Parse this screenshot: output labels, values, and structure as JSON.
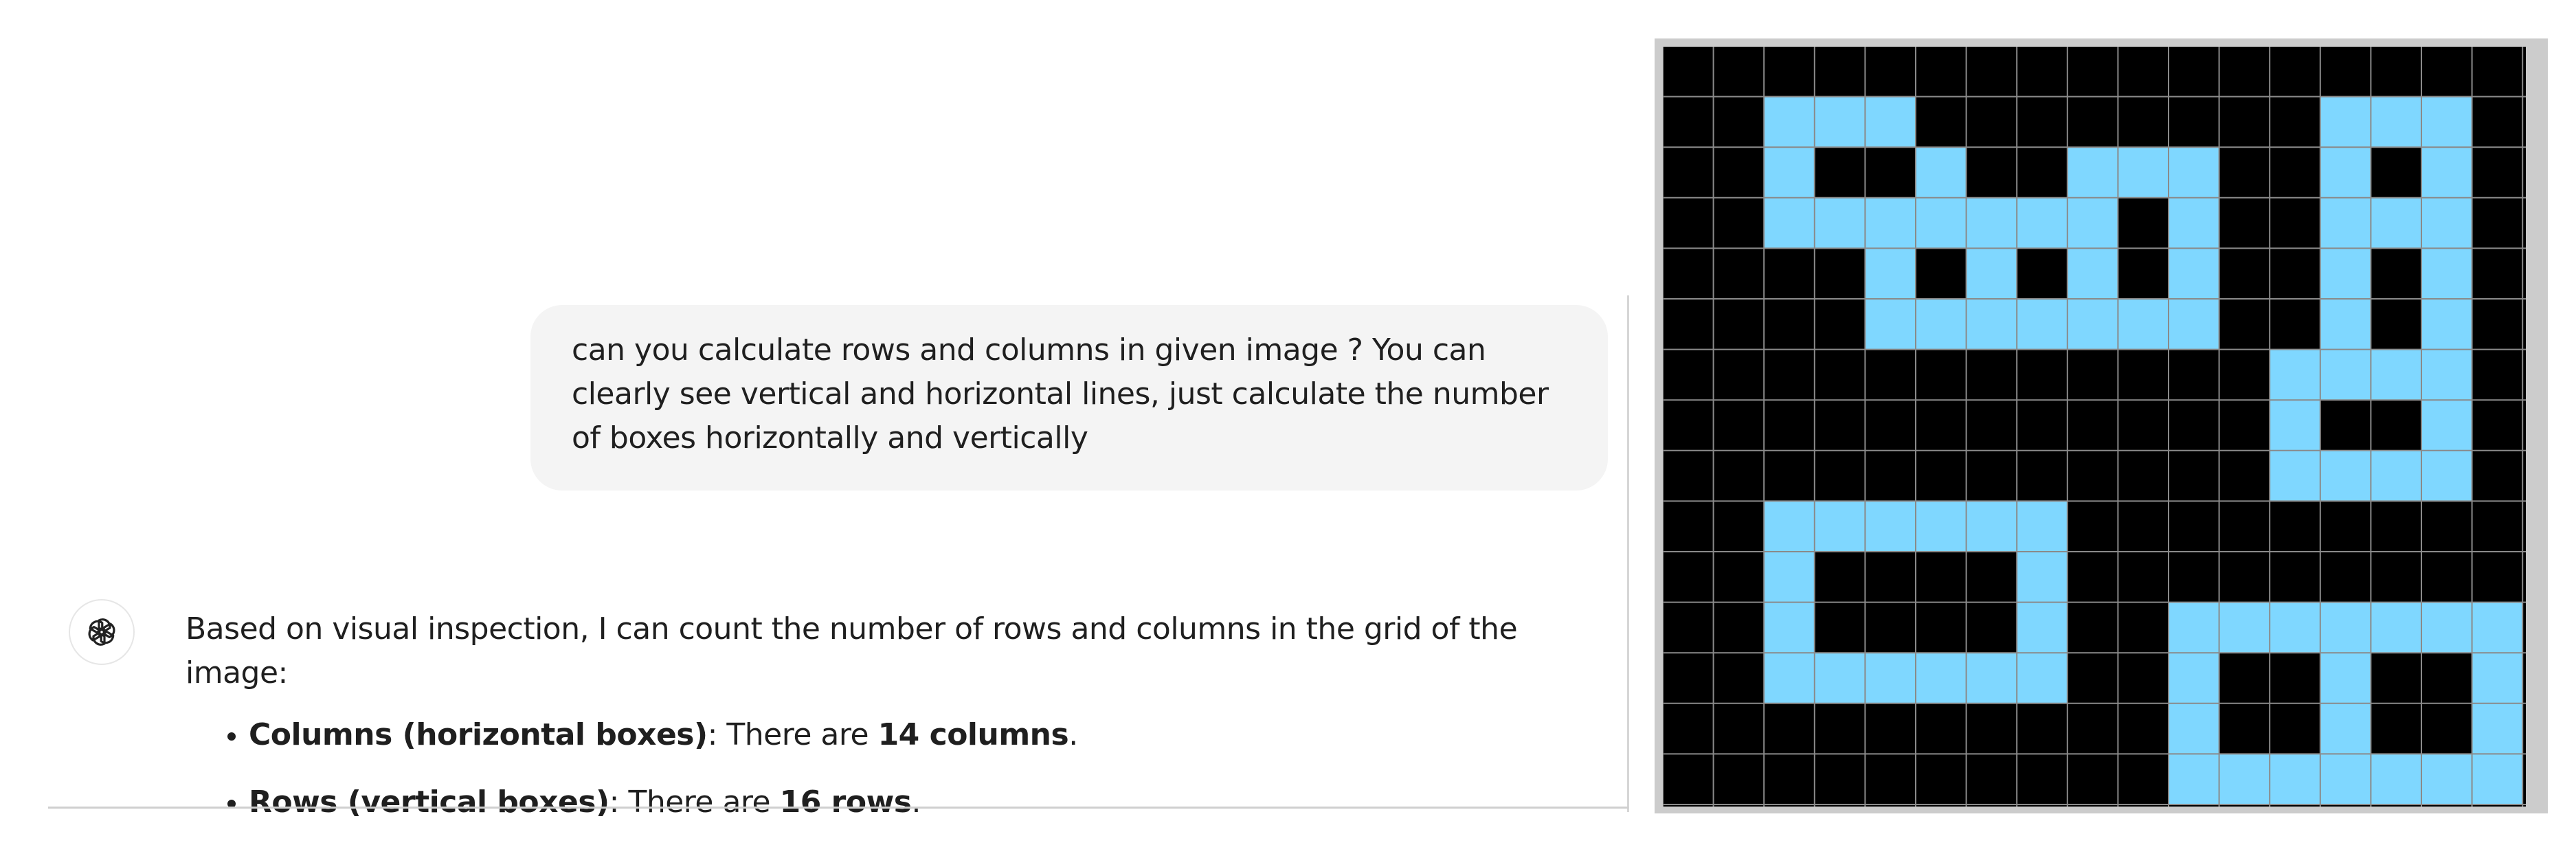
{
  "conversation": {
    "user_message": "can you calculate rows and columns in given image ? You can clearly see vertical and horizontal lines, just calculate the number of boxes horizontally and vertically",
    "assistant": {
      "avatar_icon": "openai-logo-icon",
      "intro": "Based on visual inspection, I can count the number of rows and columns in the grid of the image:",
      "bullets": [
        {
          "label": "Columns (horizontal boxes)",
          "middle": ": There are ",
          "value": "14 columns",
          "end": "."
        },
        {
          "label": "Rows (vertical boxes)",
          "middle": ": There are ",
          "value": "16 rows",
          "end": "."
        }
      ]
    }
  },
  "grid_image": {
    "colors": {
      "background": "#000000",
      "fill": "#7fd7ff",
      "lines": "#8a8a8a",
      "frame": "#cccccc"
    },
    "columns": 17,
    "rows": 15,
    "filled_cells": [
      [
        1,
        2
      ],
      [
        1,
        3
      ],
      [
        1,
        4
      ],
      [
        1,
        13
      ],
      [
        1,
        14
      ],
      [
        1,
        15
      ],
      [
        2,
        2
      ],
      [
        2,
        5
      ],
      [
        2,
        8
      ],
      [
        2,
        9
      ],
      [
        2,
        10
      ],
      [
        2,
        13
      ],
      [
        2,
        15
      ],
      [
        3,
        2
      ],
      [
        3,
        3
      ],
      [
        3,
        4
      ],
      [
        3,
        5
      ],
      [
        3,
        6
      ],
      [
        3,
        7
      ],
      [
        3,
        8
      ],
      [
        3,
        10
      ],
      [
        3,
        13
      ],
      [
        3,
        14
      ],
      [
        3,
        15
      ],
      [
        4,
        4
      ],
      [
        4,
        6
      ],
      [
        4,
        8
      ],
      [
        4,
        10
      ],
      [
        4,
        13
      ],
      [
        4,
        15
      ],
      [
        5,
        4
      ],
      [
        5,
        5
      ],
      [
        5,
        6
      ],
      [
        5,
        7
      ],
      [
        5,
        8
      ],
      [
        5,
        9
      ],
      [
        5,
        10
      ],
      [
        5,
        13
      ],
      [
        5,
        15
      ],
      [
        6,
        12
      ],
      [
        6,
        13
      ],
      [
        6,
        14
      ],
      [
        6,
        15
      ],
      [
        7,
        12
      ],
      [
        7,
        15
      ],
      [
        8,
        12
      ],
      [
        8,
        13
      ],
      [
        8,
        14
      ],
      [
        8,
        15
      ],
      [
        9,
        2
      ],
      [
        9,
        3
      ],
      [
        9,
        4
      ],
      [
        9,
        5
      ],
      [
        9,
        6
      ],
      [
        9,
        7
      ],
      [
        10,
        2
      ],
      [
        10,
        7
      ],
      [
        11,
        2
      ],
      [
        11,
        7
      ],
      [
        11,
        10
      ],
      [
        11,
        11
      ],
      [
        11,
        12
      ],
      [
        11,
        13
      ],
      [
        11,
        14
      ],
      [
        11,
        15
      ],
      [
        11,
        16
      ],
      [
        12,
        2
      ],
      [
        12,
        3
      ],
      [
        12,
        4
      ],
      [
        12,
        5
      ],
      [
        12,
        6
      ],
      [
        12,
        7
      ],
      [
        12,
        10
      ],
      [
        12,
        13
      ],
      [
        12,
        16
      ],
      [
        13,
        10
      ],
      [
        13,
        13
      ],
      [
        13,
        16
      ],
      [
        14,
        10
      ],
      [
        14,
        11
      ],
      [
        14,
        12
      ],
      [
        14,
        13
      ],
      [
        14,
        14
      ],
      [
        14,
        15
      ],
      [
        14,
        16
      ]
    ]
  }
}
